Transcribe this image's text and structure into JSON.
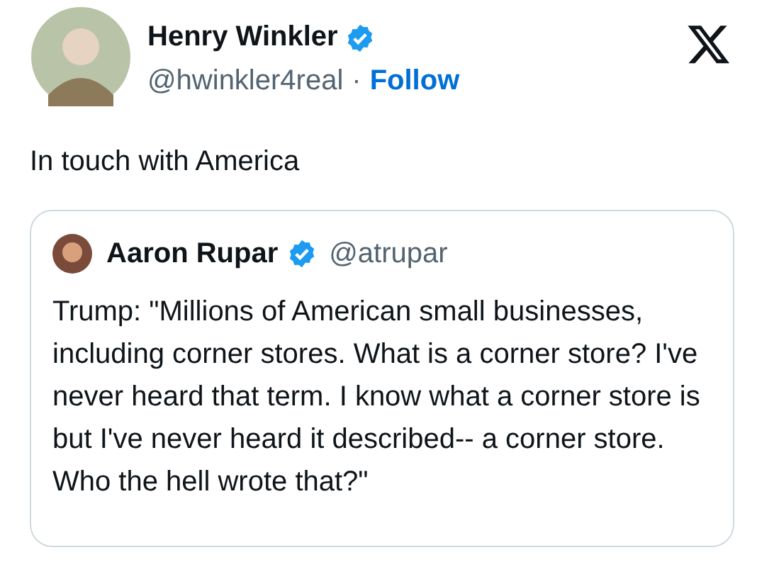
{
  "author": {
    "name": "Henry Winkler",
    "verified": true,
    "handle": "@hwinkler4real",
    "separator": "·",
    "follow": "Follow"
  },
  "text": "In touch with America",
  "quote": {
    "author": {
      "name": "Aaron Rupar",
      "verified": true,
      "handle": "@atrupar"
    },
    "text": "Trump: \"Millions of American small businesses, including corner stores. What is a corner store? I've never heard that term. I know what a corner store is but I've never heard it described-- a corner store. Who the hell wrote that?\""
  }
}
